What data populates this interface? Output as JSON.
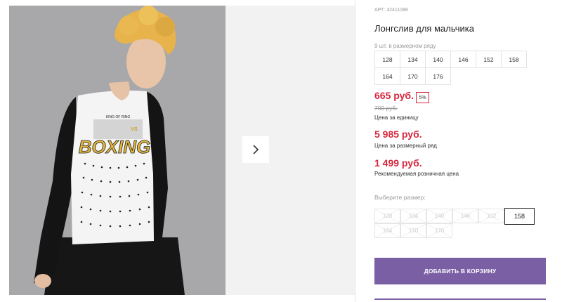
{
  "product": {
    "article": "АРТ: 32411088",
    "title": "Лонгслив для мальчика",
    "range_caption": "9 шт. в размерном ряду",
    "size_range": [
      [
        "128",
        "134",
        "140",
        "146",
        "152",
        "158"
      ],
      [
        "164",
        "170",
        "176"
      ]
    ]
  },
  "prices": {
    "unit_price": "665 руб.",
    "discount": "5%",
    "old_price": "700 руб.",
    "unit_caption": "Цена за единицу",
    "set_price": "5 985 руб.",
    "set_caption": "Цена за размерный ряд",
    "rrp_price": "1 499 руб.",
    "rrp_caption": "Рекомендуемая розничная цена"
  },
  "size_select": {
    "label": "Выберите размер:",
    "row1": [
      "128",
      "134",
      "140",
      "146",
      "152",
      "158"
    ],
    "row2": [
      "164",
      "170",
      "176"
    ],
    "selected": "158"
  },
  "cart": {
    "button_label": "ДОБАВИТЬ В КОРЗИНУ"
  },
  "photo": {
    "print_small": "KING OF RING",
    "print_vs": "VS",
    "print_main": "BOXING"
  },
  "colors": {
    "accent": "#7a5fa4",
    "price": "#d7263d"
  },
  "icons": {
    "next": "chevron-right-icon"
  }
}
